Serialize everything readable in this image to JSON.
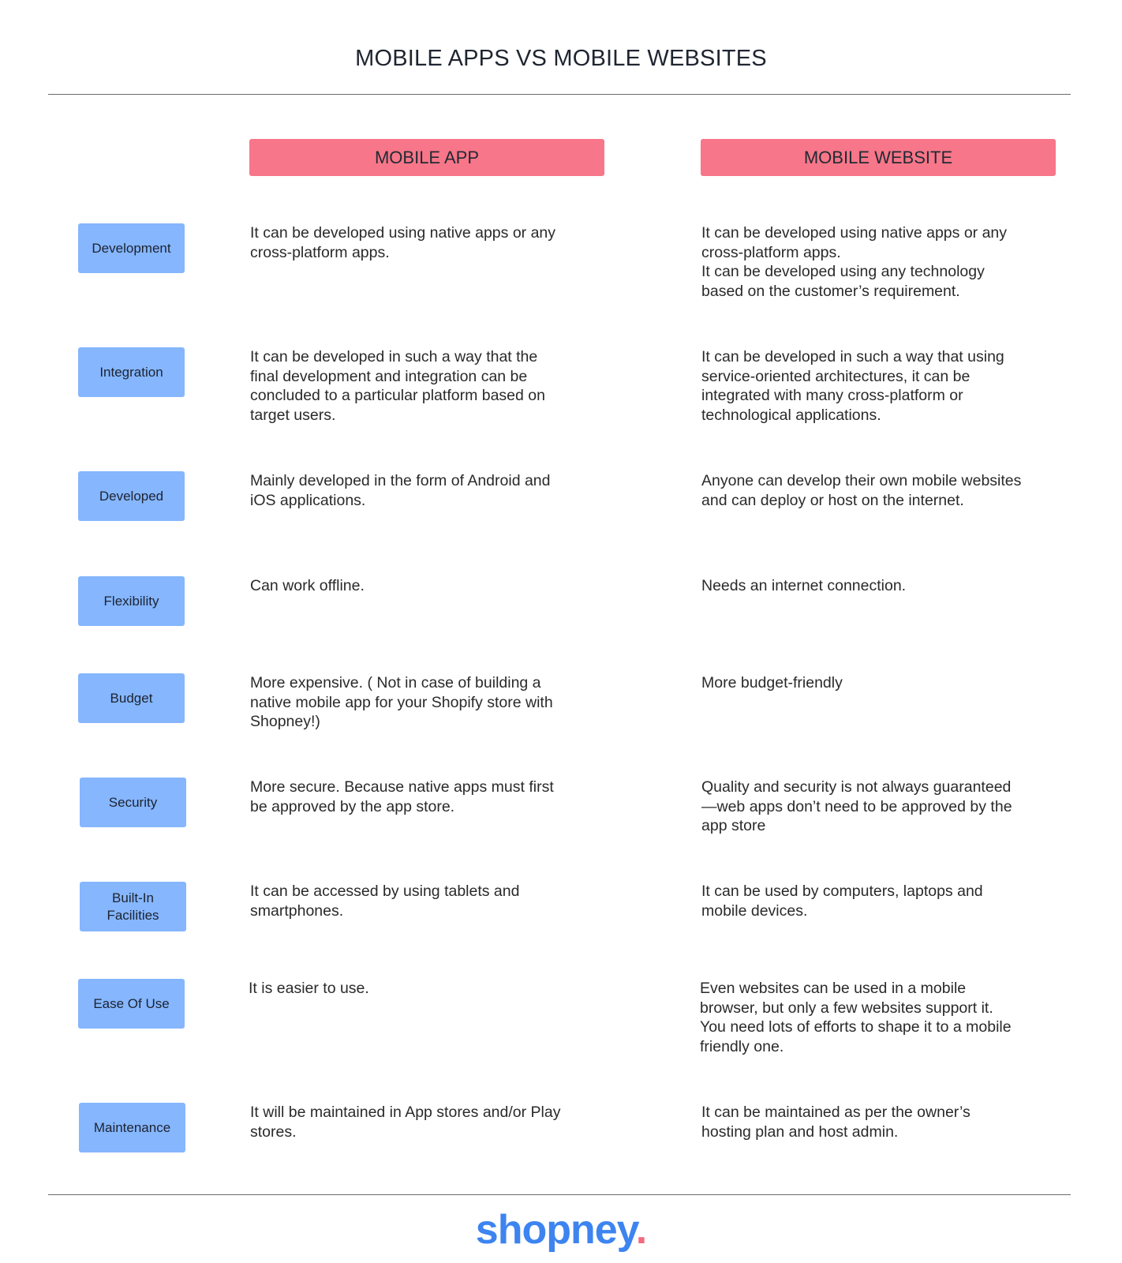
{
  "title": "MOBILE APPS VS MOBILE WEBSITES",
  "columns": {
    "app": "MOBILE APP",
    "web": "MOBILE WEBSITE"
  },
  "colors": {
    "header_pink": "#f87689",
    "label_blue": "#85b6fe",
    "logo_blue": "#3d84f0",
    "logo_dot": "#f26b7f"
  },
  "rows": [
    {
      "label": "Development",
      "app": "It can be developed using native apps or any\ncross-platform apps.",
      "web": "It can be developed using native apps or any\ncross-platform apps.\nIt can be developed using any technology\nbased on the customer’s requirement."
    },
    {
      "label": "Integration",
      "app": "It can be developed in such a way that the\nfinal development and integration can be\nconcluded to a particular platform based on\ntarget users.",
      "web": "It can be developed in such a way that using\nservice-oriented architectures, it can be\nintegrated with many cross-platform or\ntechnological applications."
    },
    {
      "label": "Developed",
      "app": "Mainly developed in the form of Android and\niOS applications.",
      "web": "Anyone can develop their own mobile websites\nand can deploy or host on the internet."
    },
    {
      "label": "Flexibility",
      "app": "Can work offline.",
      "web": "Needs an internet connection."
    },
    {
      "label": "Budget",
      "app": "More expensive. ( Not in case of building a\nnative mobile app for your Shopify store with\nShopney!)",
      "web": "More budget-friendly"
    },
    {
      "label": "Security",
      "app": "More secure. Because native apps must first\nbe approved by the app store.",
      "web": "Quality and security is not always guaranteed\n—web apps don’t need to be approved by the\napp store"
    },
    {
      "label": "Built-In Facilities",
      "app": "It can be accessed by using tablets and\nsmartphones.",
      "web": "It can be used by computers, laptops and\nmobile devices."
    },
    {
      "label": "Ease Of Use",
      "app": "It is easier to use.",
      "web": "Even websites can be used in a mobile\nbrowser, but only a few websites support it.\nYou need lots of efforts to shape it to a mobile\nfriendly one."
    },
    {
      "label": "Maintenance",
      "app": "It will be maintained in App stores and/or Play\nstores.",
      "web": "It can be maintained as per the owner’s\nhosting plan and host admin."
    }
  ],
  "logo": {
    "text": "shopney",
    "dot": "."
  }
}
